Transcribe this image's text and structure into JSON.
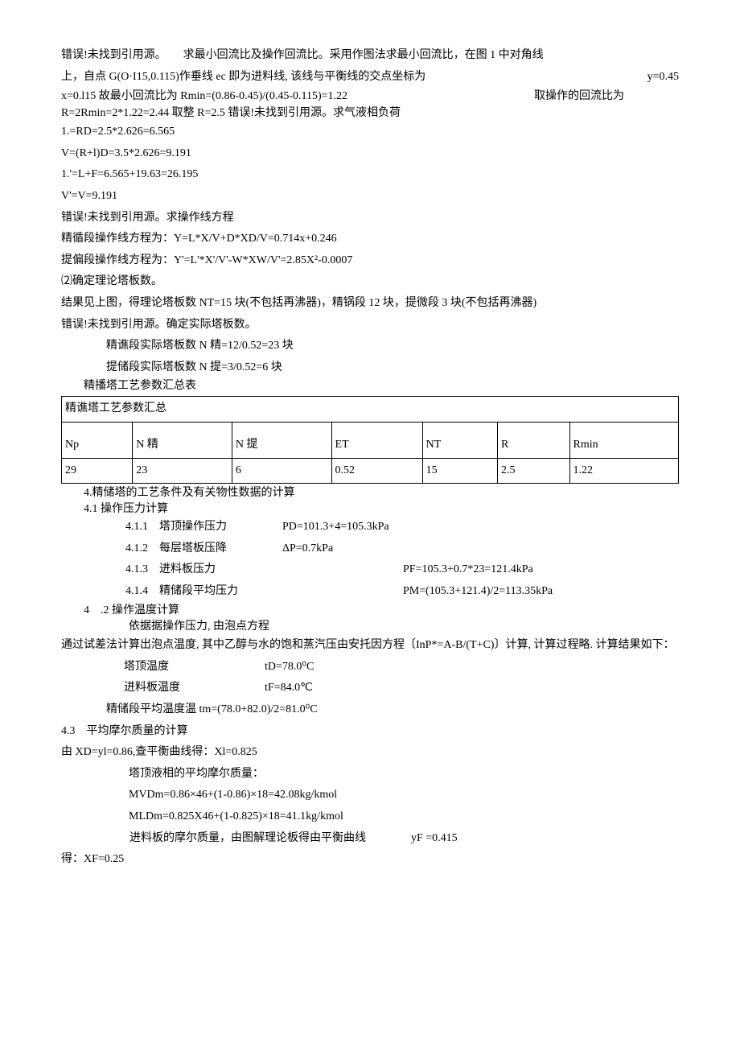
{
  "p1": "错误!未找到引用源。　　求最小回流比及操作回流比。采用作图法求最小回流比，在图 1 中对角线",
  "p2a": "上，自点 G(O·I15,0.115)作垂线 ec 即为进料线, 该线与平衡线的交点坐标为",
  "p2b": "y=0.45",
  "p3a": "x=0.l15 故最小回流比为 Rmin=(0.86-0.45)/(0.45-0.115)=1.22",
  "p3b": "取操作的回流比为",
  "p4": "R=2Rmin=2*1.22=2.44 取整 R=2.5 错误!未找到引用源。求气液相负荷",
  "p5": "1.=RD=2.5*2.626=6.565",
  "p6": "V=(R+l)D=3.5*2.626=9.191",
  "p7": "1.'=L+F=6.565+19.63=26.195",
  "p8": "V'=V=9.191",
  "p9": "错误!未找到引用源。求操作线方程",
  "p10": "精循段操作线方程为：Y=L*X/V+D*XD/V=0.714x+0.246",
  "p11": "提偏段操作线方程为：Y'=L'*X'/V'-W*XW/V'=2.85X²-0.0007",
  "p12": "⑵确定理论塔板数。",
  "p13": "结果见上图，得理论塔板数 NT=15 块(不包括再沸器)，精锅段 12 块，提微段 3 块(不包括再沸器)",
  "p14": "错误!未找到引用源。确定实际塔板数。",
  "p15": "精谯段实际塔板数 N 精=12/0.52=23 块",
  "p16": "提储段实际塔板数 N 提=3/0.52=6 块",
  "p17": "精播塔工艺参数汇总表",
  "table": {
    "title": "精谯塔工艺参数汇总",
    "headers": [
      "Np",
      "N 精",
      "N 提",
      "ET",
      "NT",
      "R",
      "Rmin"
    ],
    "values": [
      "29",
      "23",
      "6",
      "0.52",
      "15",
      "2.5",
      "1.22"
    ]
  },
  "s4": "4.精储塔的工艺条件及有关物性数据的计算",
  "s41": "4.1 操作压力计算",
  "s411a": "4.1.1　塔顶操作压力",
  "s411b": "PD=101.3+4=105.3kPa",
  "s412a": "4.1.2　每层塔板压降",
  "s412b": "ΔP=0.7kPa",
  "s413a": "4.1.3　进料板压力",
  "s413b": "PF=105.3+0.7*23=121.4kPa",
  "s414a": "4.1.4　精储段平均压力",
  "s414b": "PM=(105.3+121.4)/2=113.35kPa",
  "s42": "4　.2 操作温度计算",
  "s42a": "依据据操作压力, 由泡点方程",
  "s42b": "通过试差法计算出泡点温度, 其中乙醇与水的饱和蒸汽压由安托因方程〔InP*=A-B/(T+C)〕计算, 计算过程略. 计算结果如下：",
  "s42c_a": "塔顶温度",
  "s42c_b": "tD=78.0⁰C",
  "s42d_a": "进料板温度",
  "s42d_b": "tF=84.0℃",
  "s42e": "精储段平均温度温 tm=(78.0+82.0)/2=81.0⁰C",
  "s43": "4.3　平均摩尔质量的计算",
  "s43a": "由 XD=yl=0.86,查平衡曲线得：Xl=0.825",
  "s43b": "塔顶液相的平均摩尔质量：",
  "s43c": "MVDm=0.86×46+(1-0.86)×18=42.08kg/kmol",
  "s43d": "MLDm=0.825X46+(1-0.825)×18=41.1kg/kmol",
  "s43e_a": "进料板的摩尔质量，由图解理论板得由平衡曲线",
  "s43e_b": "yF =0.415",
  "s43f": "得：XF=0.25"
}
